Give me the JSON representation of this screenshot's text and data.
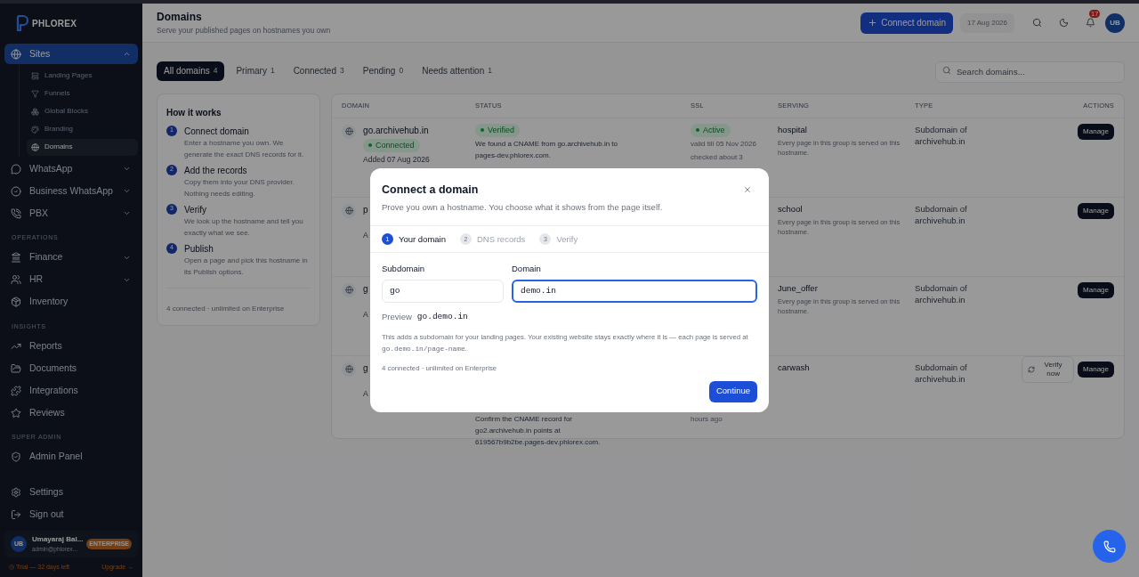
{
  "sidebar": {
    "logo": "PHLOREX",
    "nav": [
      {
        "kind": "item",
        "label": "Sites",
        "selected": true,
        "expanded": true,
        "children": [
          {
            "label": "Landing Pages",
            "selected": false
          },
          {
            "label": "Funnels",
            "selected": false
          },
          {
            "label": "Global Blocks",
            "selected": false
          },
          {
            "label": "Branding",
            "selected": false
          },
          {
            "label": "Domains",
            "selected": true
          }
        ]
      },
      {
        "kind": "item",
        "label": "WhatsApp",
        "selected": false,
        "expanded": false
      },
      {
        "kind": "item",
        "label": "Business WhatsApp",
        "selected": false,
        "expanded": false
      },
      {
        "kind": "item",
        "label": "PBX",
        "selected": false,
        "expanded": false
      },
      {
        "kind": "section",
        "label": "OPERATIONS"
      },
      {
        "kind": "item",
        "label": "Finance",
        "selected": false,
        "expanded": false
      },
      {
        "kind": "item",
        "label": "HR",
        "selected": false,
        "expanded": false
      },
      {
        "kind": "item",
        "label": "Inventory",
        "selected": false
      },
      {
        "kind": "section",
        "label": "INSIGHTS"
      },
      {
        "kind": "item",
        "label": "Reports",
        "selected": false
      },
      {
        "kind": "item",
        "label": "Documents",
        "selected": false
      },
      {
        "kind": "item",
        "label": "Integrations",
        "selected": false
      },
      {
        "kind": "item",
        "label": "Reviews",
        "selected": false
      },
      {
        "kind": "section",
        "label": "SUPER ADMIN"
      },
      {
        "kind": "item",
        "label": "Admin Panel",
        "selected": false
      }
    ],
    "bottom": [
      {
        "label": "Settings"
      },
      {
        "label": "Sign out"
      }
    ],
    "user": {
      "initials": "UB",
      "name": "Umayaraj Bal...",
      "email": "admin@phlorex...",
      "plan": "ENTERPRISE"
    },
    "trial": {
      "text": "Trial — 32 days left",
      "link": "Upgrade →"
    }
  },
  "header": {
    "title": "Domains",
    "subtitle": "Serve your published pages on hostnames you own",
    "primary_button": "Connect domain",
    "date": "17 Aug 2026",
    "notifications": "17",
    "avatar": "UB"
  },
  "tabs": [
    {
      "label": "All domains",
      "count": "4",
      "selected": true
    },
    {
      "label": "Primary",
      "count": "1",
      "selected": false
    },
    {
      "label": "Connected",
      "count": "3",
      "selected": false
    },
    {
      "label": "Pending",
      "count": "0",
      "selected": false
    },
    {
      "label": "Needs attention",
      "count": "1",
      "selected": false
    }
  ],
  "search": {
    "placeholder": "Search domains..."
  },
  "how_it_works": {
    "title": "How it works",
    "steps": [
      {
        "number": "1",
        "title": "Connect domain",
        "text": "Enter a hostname you own. We generate the exact DNS records for it."
      },
      {
        "number": "2",
        "title": "Add the records",
        "text": "Copy them into your DNS provider. Nothing needs editing."
      },
      {
        "number": "3",
        "title": "Verify",
        "text": "We look up the hostname and tell you exactly what we see."
      },
      {
        "number": "4",
        "title": "Publish",
        "text": "Open a page and pick this hostname in its Publish options."
      }
    ],
    "footer": "4 connected · unlimited on Enterprise"
  },
  "table": {
    "columns": [
      "DOMAIN",
      "STATUS",
      "SSL",
      "SERVING",
      "TYPE",
      "ACTIONS"
    ],
    "rows": [
      {
        "domain": "go.archivehub.in",
        "domain_badge": {
          "label": "Connected"
        },
        "added": "Added 07 Aug 2026",
        "status_badge": {
          "label": "Verified"
        },
        "status_text": "We found a CNAME from go.archivehub.in to pages-dev.phlorex.com.",
        "ssl_badge": {
          "label": "Active"
        },
        "ssl_text": "valid till 05 Nov 2026",
        "ssl_note": "checked about 3",
        "serving": "hospital",
        "serving_note": "Every page in this group is served on this hostname.",
        "type": "Subdomain of archivehub.in",
        "actions": [
          {
            "kind": "solid",
            "label": "Manage"
          }
        ]
      },
      {
        "domain": "p",
        "added": "A",
        "serving": "school",
        "serving_note": "Every page in this group is served on this hostname.",
        "type": "Subdomain of archivehub.in",
        "actions": [
          {
            "kind": "solid",
            "label": "Manage"
          }
        ]
      },
      {
        "domain": "g",
        "added": "A",
        "serving": "June_offer",
        "serving_note": "Every page in this group is served on this hostname.",
        "type": "Subdomain of archivehub.in",
        "actions": [
          {
            "kind": "solid",
            "label": "Manage"
          }
        ]
      },
      {
        "domain": "g",
        "added": "A",
        "status_text": "Confirm the CNAME record for go2.archivehub.in points at 619567b9b2be.pages-dev.phlorex.com.",
        "ssl_note": "hours ago",
        "serving": "carwash",
        "type": "Subdomain of archivehub.in",
        "actions": [
          {
            "kind": "outline",
            "label": "Verify now"
          },
          {
            "kind": "solid",
            "label": "Manage"
          }
        ]
      }
    ]
  },
  "modal": {
    "title": "Connect a domain",
    "subtitle": "Prove you own a hostname. You choose what it shows from the page itself.",
    "steps": [
      {
        "number": "1",
        "label": "Your domain",
        "selected": true
      },
      {
        "number": "2",
        "label": "DNS records",
        "selected": false
      },
      {
        "number": "3",
        "label": "Verify",
        "selected": false
      }
    ],
    "fields": [
      {
        "label": "Subdomain",
        "value": "go",
        "focused": false
      },
      {
        "label": "Domain",
        "value": "demo.in",
        "focused": true
      }
    ],
    "preview": {
      "label": "Preview",
      "value": "go.demo.in"
    },
    "info": {
      "before": "This adds a subdomain for your landing pages. Your existing website stays exactly where it is — each page is served at ",
      "code": "go.demo.in/page-name",
      "after": "."
    },
    "usage": "4 connected · unlimited on Enterprise",
    "button": "Continue"
  }
}
